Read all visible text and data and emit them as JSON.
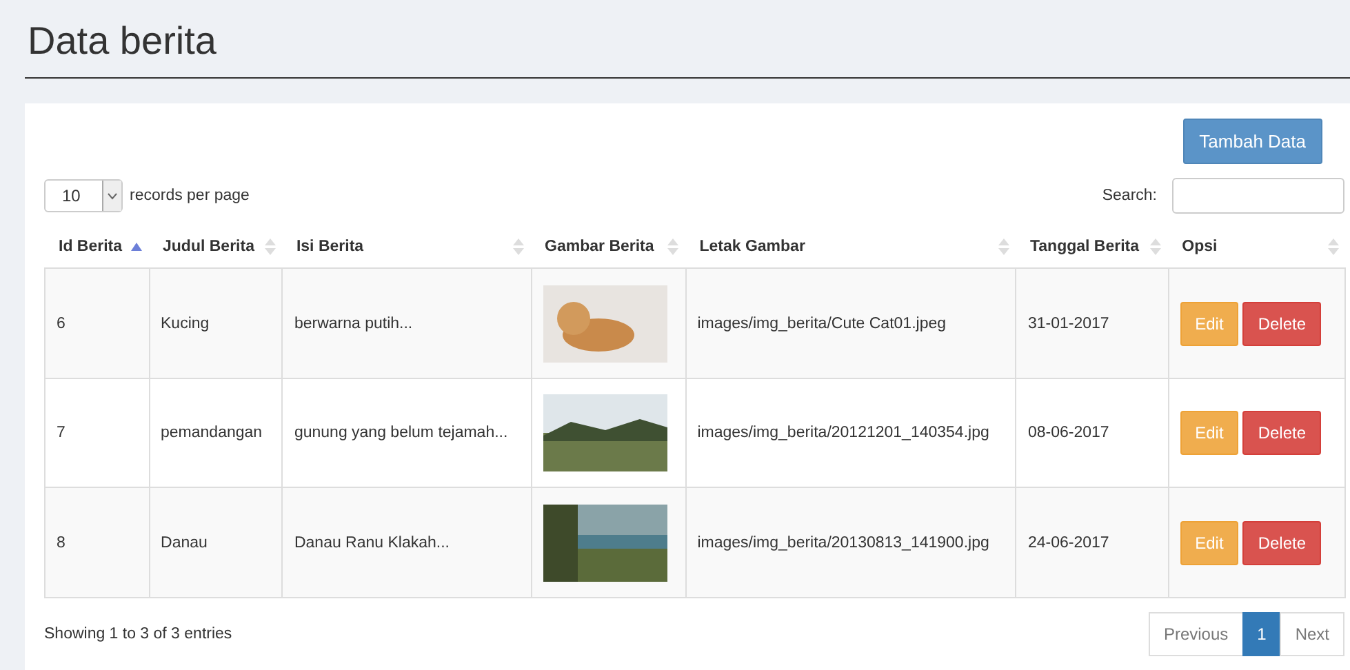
{
  "page_title": "Data berita",
  "add_button": "Tambah Data",
  "length_select": {
    "value": "10",
    "label": "records per page"
  },
  "search": {
    "label": "Search:"
  },
  "table": {
    "columns": [
      {
        "label": "Id Berita",
        "sorted": true
      },
      {
        "label": "Judul Berita",
        "sorted": false
      },
      {
        "label": "Isi Berita",
        "sorted": false
      },
      {
        "label": "Gambar Berita",
        "sorted": false
      },
      {
        "label": "Letak Gambar",
        "sorted": false
      },
      {
        "label": "Tanggal Berita",
        "sorted": false
      },
      {
        "label": "Opsi",
        "sorted": false
      }
    ],
    "rows": [
      {
        "id": "6",
        "title": "Kucing",
        "content": "berwarna putih...",
        "path": "images/img_berita/Cute Cat01.jpeg",
        "date": "31-01-2017",
        "actions": [
          "Edit",
          "Delete"
        ]
      },
      {
        "id": "7",
        "title": "pemandangan",
        "content": "gunung yang belum tejamah...",
        "path": "images/img_berita/20121201_140354.jpg",
        "date": "08-06-2017",
        "actions": [
          "Edit",
          "Delete"
        ]
      },
      {
        "id": "8",
        "title": "Danau",
        "content": "Danau Ranu Klakah...",
        "path": "images/img_berita/20130813_141900.jpg",
        "date": "24-06-2017",
        "actions": [
          "Edit",
          "Delete"
        ]
      }
    ]
  },
  "info": "Showing 1 to 3 of 3 entries",
  "pagination": [
    {
      "label": "Previous",
      "disabled": true,
      "selected": false
    },
    {
      "label": "1",
      "disabled": false,
      "selected": true
    },
    {
      "label": "Next",
      "disabled": true,
      "selected": false
    }
  ]
}
